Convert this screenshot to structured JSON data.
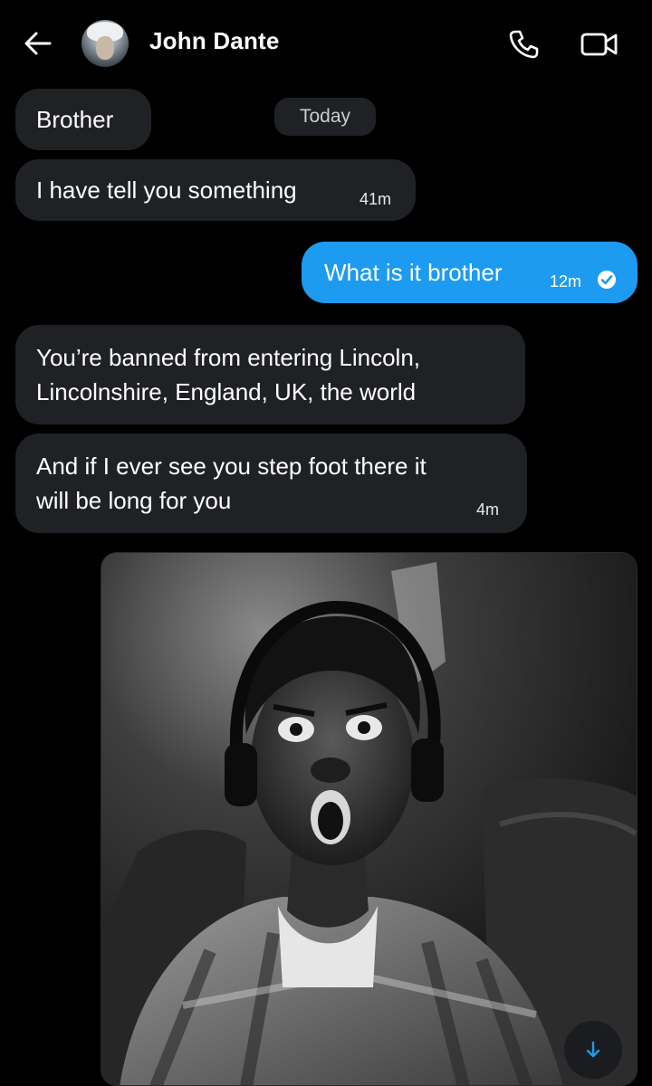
{
  "header": {
    "contact_name": "John Dante",
    "back_icon": "arrow-left-icon",
    "call_icon": "phone-icon",
    "video_icon": "video-camera-icon"
  },
  "divider": {
    "label": "Today"
  },
  "messages": [
    {
      "side": "left",
      "text": "Brother",
      "time": ""
    },
    {
      "side": "left",
      "text": "I have tell you something",
      "time": "41m"
    },
    {
      "side": "right",
      "text": "What is it brother",
      "time": "12m",
      "status": "read"
    },
    {
      "side": "left",
      "lines": [
        "You’re banned from entering Lincoln,",
        "Lincolnshire, England, UK, the world"
      ],
      "time": ""
    },
    {
      "side": "left",
      "lines": [
        "And if I ever see you step foot there it",
        "will be long for you"
      ],
      "time": "4m"
    }
  ],
  "media": {
    "type": "image",
    "description_icon": "photo-image"
  },
  "scroll_button": {
    "icon": "arrow-down-icon"
  },
  "colors": {
    "background": "#000000",
    "incoming_bubble": "#1f2125",
    "outgoing_bubble": "#1d9bf0",
    "accent": "#1d9bf0"
  }
}
